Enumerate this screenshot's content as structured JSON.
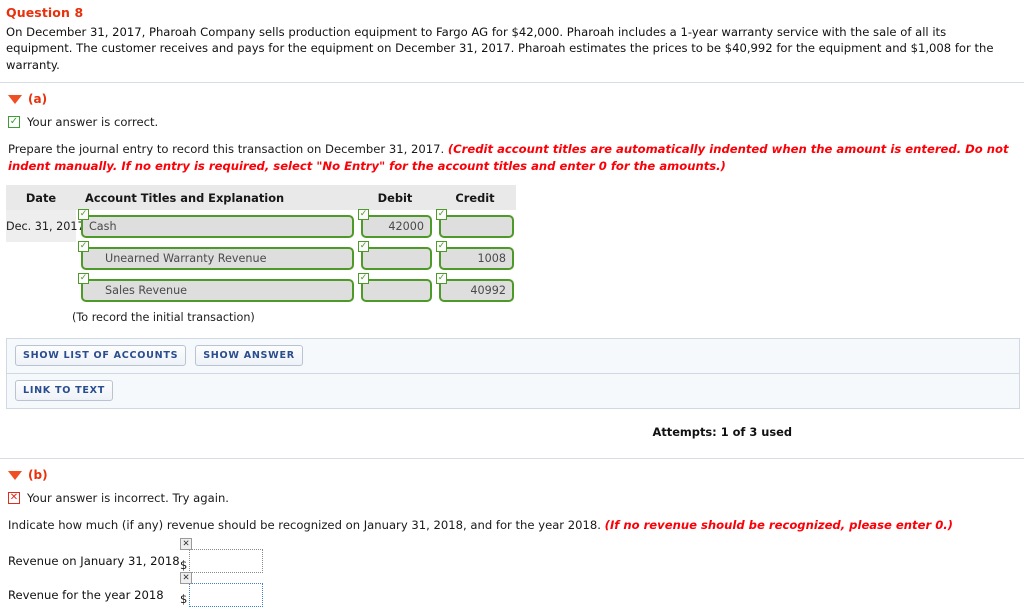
{
  "question": {
    "title": "Question 8",
    "body": "On December 31, 2017, Pharoah Company sells production equipment to Fargo AG for $42,000. Pharoah includes a 1-year warranty service with the sale of all its equipment. The customer receives and pays for the equipment on December 31, 2017. Pharoah estimates the prices to be $40,992 for the equipment and $1,008 for the warranty."
  },
  "part_a": {
    "label": "(a)",
    "result_badge": "✓",
    "result_text": "Your answer is correct.",
    "instruction_plain": "Prepare the journal entry to record this transaction on December 31, 2017. ",
    "instruction_emphasis": "(Credit account titles are automatically indented when the amount is entered. Do not indent manually. If no entry is required, select \"No Entry\" for the account titles and enter 0 for the amounts.)",
    "table": {
      "headers": [
        "Date",
        "Account Titles and Explanation",
        "Debit",
        "Credit"
      ],
      "rows": [
        {
          "date": "Dec. 31, 2017",
          "account": "Cash",
          "indent": false,
          "debit": "42000",
          "credit": "",
          "tick": "✓"
        },
        {
          "date": "",
          "account": "Unearned Warranty Revenue",
          "indent": true,
          "debit": "",
          "credit": "1008",
          "tick": "✓"
        },
        {
          "date": "",
          "account": "Sales Revenue",
          "indent": true,
          "debit": "",
          "credit": "40992",
          "tick": "✓"
        }
      ],
      "memo": "(To record the initial transaction)"
    },
    "buttons": {
      "show_list_of_accounts": "SHOW LIST OF ACCOUNTS",
      "show_answer": "SHOW ANSWER",
      "link_to_text": "LINK TO TEXT"
    },
    "attempts": "Attempts: 1 of 3 used"
  },
  "part_b": {
    "label": "(b)",
    "result_badge": "✕",
    "result_text": "Your answer is incorrect.  Try again.",
    "instruction_plain": "Indicate how much (if any) revenue should be recognized on January 31, 2018, and for the year 2018. ",
    "instruction_emphasis": "(If no revenue should be recognized, please enter 0.)",
    "answers": [
      {
        "label": "Revenue on January 31, 2018",
        "currency": "$",
        "value": "",
        "mark": "✕",
        "focused": false
      },
      {
        "label": "Revenue for the year 2018",
        "currency": "$",
        "value": "",
        "mark": "✕",
        "focused": true
      }
    ]
  },
  "colors": {
    "accent_red": "#e8310c",
    "emphasis_red": "#fb0007",
    "input_green": "#4e9a28",
    "button_blue": "#2a4d8f",
    "focus_blue": "#3f7fd0"
  }
}
